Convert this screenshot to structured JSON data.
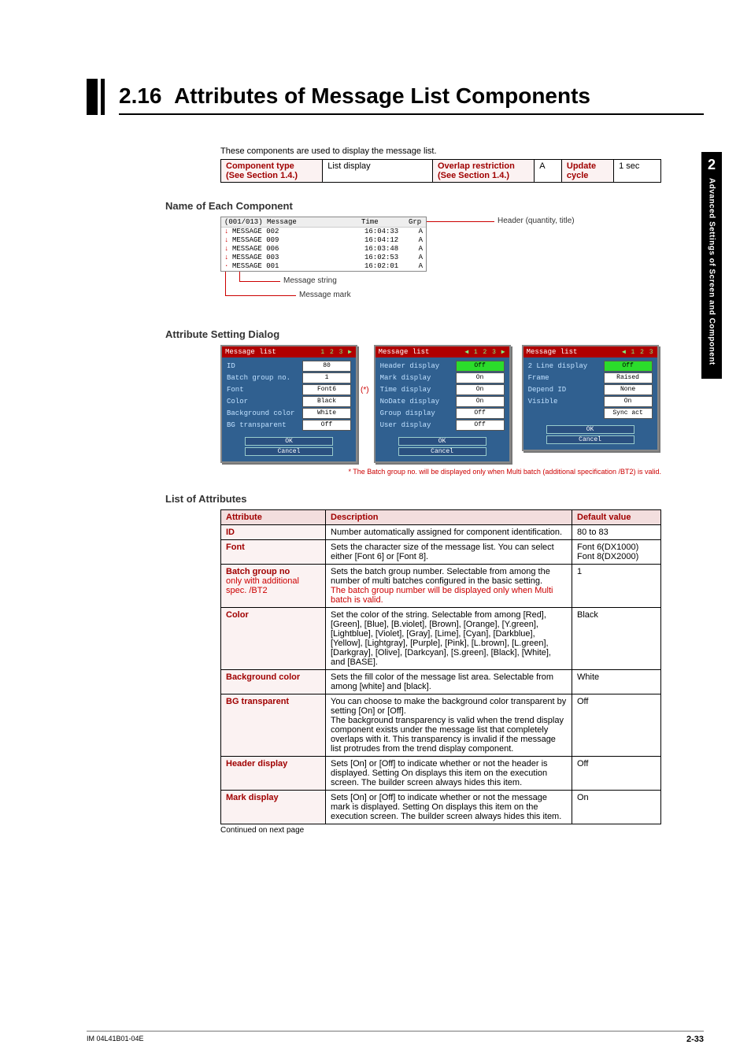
{
  "side_tab": {
    "num": "2",
    "text": "Advanced Settings of Screen and Component"
  },
  "heading": {
    "num": "2.16",
    "title": "Attributes of Message List Components"
  },
  "intro": "These components are used to display the message list.",
  "mini_table": {
    "h1": "Component type\n(See Section 1.4.)",
    "v1": "List display",
    "h2": "Overlap restriction\n(See Section 1.4.)",
    "v2": "A",
    "h3": "Update cycle",
    "v3": "1 sec"
  },
  "sec1": "Name of Each Component",
  "msg_header": {
    "left": "(001/013) Message",
    "time_h": "Time",
    "grp_h": "Grp"
  },
  "msg_rows": [
    {
      "tick": "↓",
      "name": "MESSAGE 002",
      "time": "16:04:33",
      "grp": "A"
    },
    {
      "tick": "↓",
      "name": "MESSAGE 009",
      "time": "16:04:12",
      "grp": "A"
    },
    {
      "tick": "↓",
      "name": "MESSAGE 006",
      "time": "16:03:48",
      "grp": "A"
    },
    {
      "tick": "↓",
      "name": "MESSAGE 003",
      "time": "16:02:53",
      "grp": "A"
    },
    {
      "tick": "·",
      "name": "MESSAGE 001",
      "time": "16:02:01",
      "grp": "A"
    }
  ],
  "callouts": {
    "header": "Header (quantity, title)",
    "string": "Message string",
    "mark": "Message mark"
  },
  "sec2": "Attribute Setting Dialog",
  "dialogs": [
    {
      "title": "Message list",
      "pager": "1 2 3 ▶",
      "rows": [
        [
          "ID",
          "80",
          false
        ],
        [
          "Batch group no.",
          "1",
          false
        ],
        [
          "Font",
          "Font6",
          false
        ],
        [
          "Color",
          "Black",
          false
        ],
        [
          "Background color",
          "White",
          false
        ],
        [
          "BG transparent",
          "Off",
          false
        ]
      ]
    },
    {
      "title": "Message list",
      "pager": "◀ 1 2 3 ▶",
      "rows": [
        [
          "Header display",
          "Off",
          true
        ],
        [
          "Mark display",
          "On",
          false
        ],
        [
          "Time display",
          "On",
          false
        ],
        [
          "NoDate display",
          "On",
          false
        ],
        [
          "Group display",
          "Off",
          false
        ],
        [
          "User display",
          "Off",
          false
        ]
      ]
    },
    {
      "title": "Message list",
      "pager": "◀ 1 2 3",
      "rows": [
        [
          "2 Line display",
          "Off",
          true
        ],
        [
          "Frame",
          "Raised",
          false
        ],
        [
          "Depend ID",
          "None",
          false
        ],
        [
          "Visible",
          "On",
          false
        ],
        [
          "",
          "Sync act",
          false
        ]
      ]
    }
  ],
  "dlg_btn_ok": "OK",
  "dlg_btn_cancel": "Cancel",
  "star": "(*)",
  "star_note": "* The Batch group no. will be displayed only when Multi  batch (additional specification /BT2) is valid.",
  "sec3": "List of Attributes",
  "attr_headers": [
    "Attribute",
    "Description",
    "Default value"
  ],
  "attrs": [
    {
      "name": "ID",
      "sub": "",
      "desc": "Number automatically assigned for component identification.",
      "def": "80 to 83"
    },
    {
      "name": "Font",
      "sub": "",
      "desc": "Sets the character size of the message list. You can select either [Font 6] or [Font 8].",
      "def": "Font 6(DX1000)\nFont 8(DX2000)"
    },
    {
      "name": "Batch group no",
      "sub": "only with additional spec. /BT2",
      "desc": "Sets the batch group number. Selectable from among the number of multi batches configured in the basic setting.",
      "desc_red": "The batch group number will be displayed only when Multi batch is valid.",
      "def": "1"
    },
    {
      "name": "Color",
      "sub": "",
      "desc": "Set the color of the string. Selectable from among [Red], [Green], [Blue], [B.violet], [Brown], [Orange], [Y.green], [Lightblue], [Violet], [Gray], [Lime], [Cyan], [Darkblue], [Yellow], [Lightgray], [Purple], [Pink], [L.brown], [L.green], [Darkgray], [Olive], [Darkcyan], [S.green], [Black], [White], and [BASE].",
      "def": "Black"
    },
    {
      "name": "Background color",
      "sub": "",
      "desc": "Sets the fill color of the message list area.  Selectable from among [white] and [black].",
      "def": "White"
    },
    {
      "name": "BG transparent",
      "sub": "",
      "desc": "You can choose to make the background color transparent by setting [On] or [Off].\nThe background transparency is valid when the trend display component exists under the message list that completely overlaps with it.  This transparency is invalid if the message list protrudes from the trend display component.",
      "def": "Off"
    },
    {
      "name": "Header display",
      "sub": "",
      "desc": "Sets [On] or [Off] to indicate whether or not the header is displayed. Setting On displays this item on the execution screen.  The builder screen always hides this item.",
      "def": "Off"
    },
    {
      "name": "Mark display",
      "sub": "",
      "desc": "Sets [On] or [Off] to indicate whether or not the message mark is displayed.  Setting On displays this item on the execution screen.  The builder screen always hides this item.",
      "def": "On"
    }
  ],
  "continued": "Continued on next page",
  "footer": {
    "left": "IM 04L41B01-04E",
    "right": "2-33"
  }
}
